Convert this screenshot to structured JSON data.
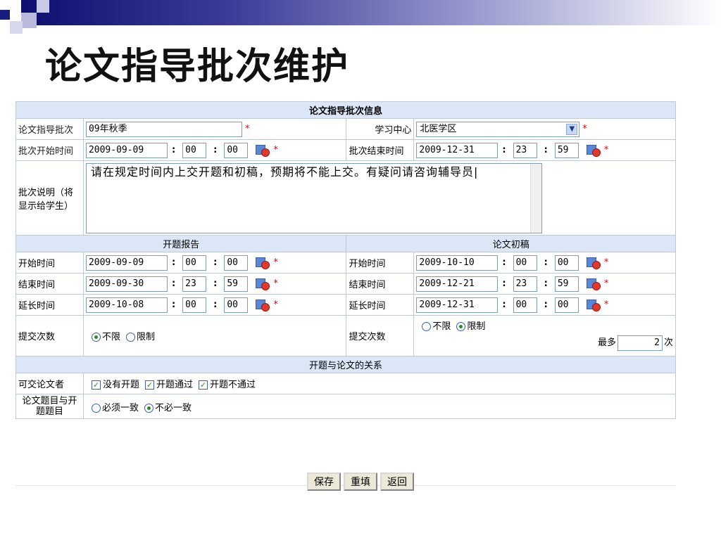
{
  "slide_title": "论文指导批次维护",
  "header_label": "论文指导批次信息",
  "batch": {
    "label": "论文指导批次",
    "value": "09年秋季"
  },
  "center": {
    "label": "学习中心",
    "value": "北医学区"
  },
  "batch_start": {
    "label": "批次开始时间",
    "date": "2009-09-09",
    "hh": "00",
    "mm": "00"
  },
  "batch_end": {
    "label": "批次结束时间",
    "date": "2009-12-31",
    "hh": "23",
    "mm": "59"
  },
  "desc": {
    "label": "批次说明（将显示给学生）",
    "value": "请在规定时间内上交开题和初稿，预期将不能上交。有疑问请咨询辅导员|"
  },
  "proposal": {
    "section": "开题报告",
    "start": {
      "label": "开始时间",
      "date": "2009-09-09",
      "hh": "00",
      "mm": "00"
    },
    "end": {
      "label": "结束时间",
      "date": "2009-09-30",
      "hh": "23",
      "mm": "59"
    },
    "ext": {
      "label": "延长时间",
      "date": "2009-10-08",
      "hh": "00",
      "mm": "00"
    },
    "submit": {
      "label": "提交次数",
      "opt1": "不限",
      "opt2": "限制"
    }
  },
  "draft": {
    "section": "论文初稿",
    "start": {
      "label": "开始时间",
      "date": "2009-10-10",
      "hh": "00",
      "mm": "00"
    },
    "end": {
      "label": "结束时间",
      "date": "2009-12-21",
      "hh": "23",
      "mm": "59"
    },
    "ext": {
      "label": "延长时间",
      "date": "2009-12-31",
      "hh": "00",
      "mm": "00"
    },
    "submit": {
      "label": "提交次数",
      "opt1": "不限",
      "opt2": "限制",
      "max_label": "最多",
      "max_value": "2",
      "unit": "次"
    }
  },
  "relation": {
    "section": "开题与论文的关系",
    "who_label": "可交论文者",
    "cb1": "没有开题",
    "cb2": "开题通过",
    "cb3": "开题不通过",
    "topic_label": "论文题目与开题题目",
    "r1": "必须一致",
    "r2": "不必一致"
  },
  "buttons": {
    "save": "保存",
    "reset": "重填",
    "back": "返回"
  },
  "required": "*",
  "colon": ":"
}
